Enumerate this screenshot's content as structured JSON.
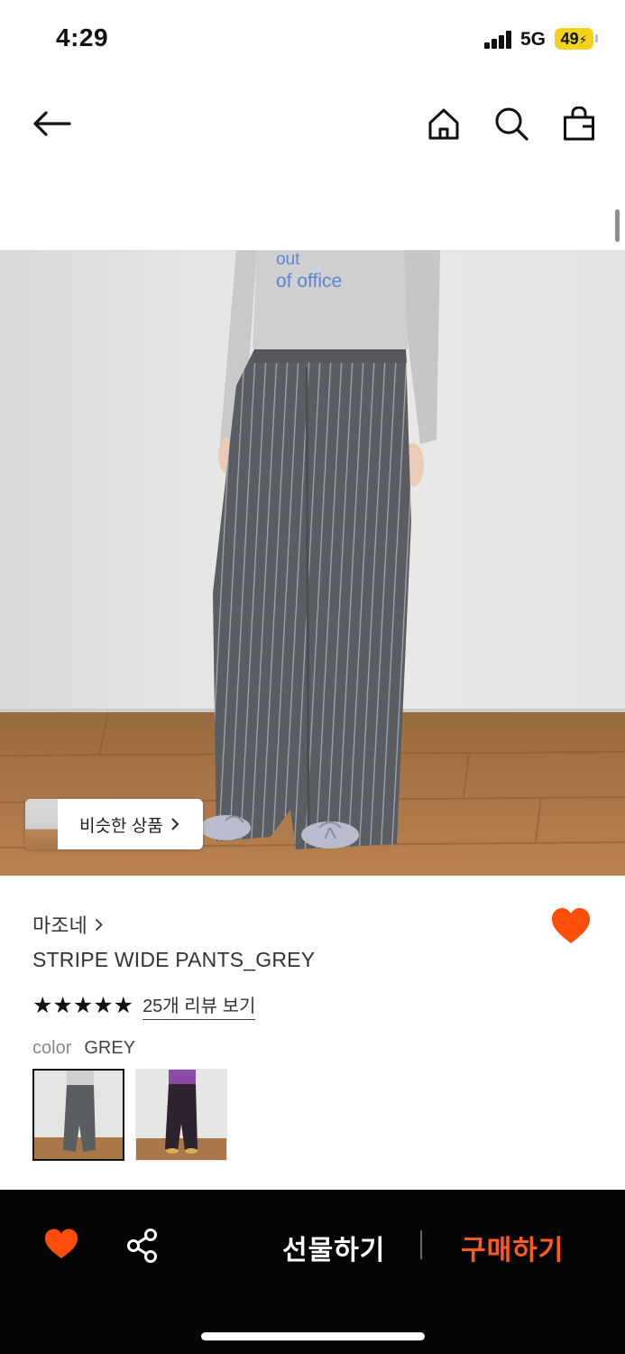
{
  "status_bar": {
    "time": "4:29",
    "network": "5G",
    "battery": "49"
  },
  "header": {
    "back_icon": "arrow-left-icon",
    "home_icon": "home-icon",
    "search_icon": "search-icon",
    "bag_icon": "shopping-bag-icon"
  },
  "product_image": {
    "shirt_text_line1": "out",
    "shirt_text_line2": "of office"
  },
  "similar_button": {
    "label": "비슷한 상품",
    "icon": "chevron-right-icon"
  },
  "product": {
    "brand": "마조네",
    "name": "STRIPE WIDE PANTS_GREY",
    "stars": "★★★★★",
    "rating": 5,
    "review_link": "25개 리뷰 보기",
    "color_label": "color",
    "color_value": "GREY",
    "wished": true
  },
  "bottom_bar": {
    "gift_label": "선물하기",
    "buy_label": "구매하기"
  },
  "colors": {
    "accent": "#ff4d0a",
    "buy_text": "#ff5a1f",
    "bar_bg": "#050505",
    "battery": "#f2d21a"
  }
}
